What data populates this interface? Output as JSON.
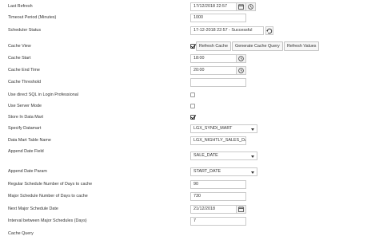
{
  "form": {
    "last_refresh": {
      "label": "Last Refresh",
      "value": "17/12/2018 22:57"
    },
    "timeout_period": {
      "label": "Timeout Period (Minutes)",
      "value": "1000"
    },
    "scheduler_status": {
      "label": "Scheduler Status",
      "value": "17-12-2018 22:57 - Successful"
    },
    "cache_view": {
      "label": "Cache View",
      "checked": true,
      "buttons": [
        "Refresh Cache",
        "Generate Cache Query",
        "Refresh Values"
      ]
    },
    "cache_start": {
      "label": "Cache Start",
      "value": "18:00"
    },
    "cache_end_time": {
      "label": "Cache End Time",
      "value": "20:00"
    },
    "cache_threshold": {
      "label": "Cache Threshold",
      "value": ""
    },
    "use_direct_sql": {
      "label": "Use direct SQL in Login Professional",
      "checked": false
    },
    "use_server_mode": {
      "label": "Use Server Mode",
      "checked": false
    },
    "store_in_data_mart": {
      "label": "Store In Data Mart",
      "checked": true
    },
    "specify_datamart": {
      "label": "Specify Datamart",
      "value": "LGX_SYNDI_MART"
    },
    "data_mart_table_name": {
      "label": "Data Mart Table Name",
      "value": "LGX_NIGHTLY_SALES_DA"
    },
    "append_date_field": {
      "label": "Append Date Field",
      "value": "SALE_DATE"
    },
    "append_date_param": {
      "label": "Append Date Param",
      "value": "START_DATE"
    },
    "regular_schedule_days": {
      "label": "Regular Schedule Number of Days to cache",
      "value": "90"
    },
    "major_schedule_days": {
      "label": "Major Schedule Number of Days to cache",
      "value": "730"
    },
    "next_major_schedule_date": {
      "label": "Next Major Schedule Date",
      "value": "21/12/2018"
    },
    "interval_major_schedules": {
      "label": "Interval between Major Schedules (Days)",
      "value": "7"
    },
    "cache_query": {
      "label": "Cache Query"
    }
  },
  "icons": {
    "calendar": "calendar-icon",
    "clock": "clock-icon",
    "refresh": "refresh-icon",
    "dropdown": "chevron-down-icon",
    "check": "check-icon"
  }
}
